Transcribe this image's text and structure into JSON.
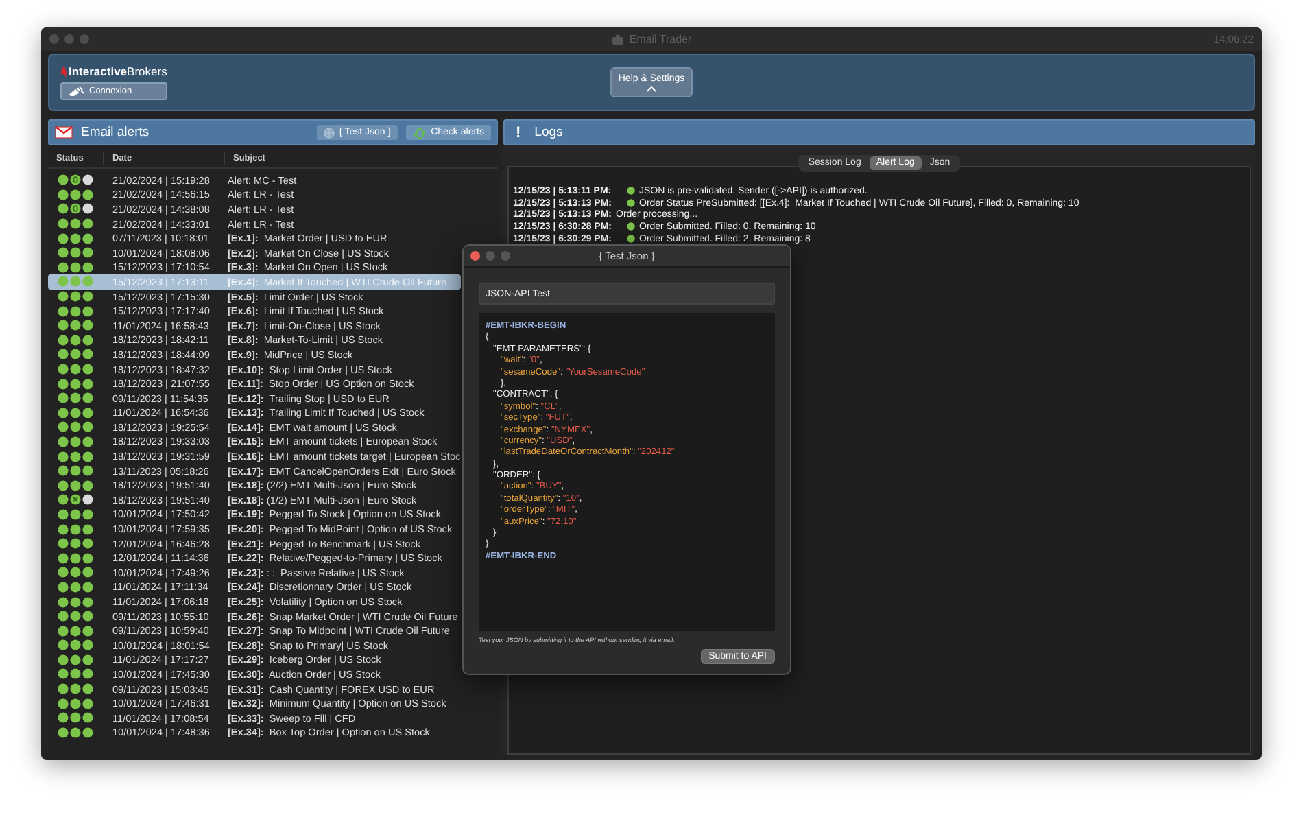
{
  "window": {
    "title": "Email Trader",
    "clock": "14:06:22"
  },
  "header": {
    "logo": "**Interactive**Brokers",
    "connect_button": "Connexion",
    "help_button": "Help & Settings"
  },
  "alerts": {
    "title": "Email alerts",
    "test_button": "{ Test Json }",
    "check_button": "Check alerts",
    "columns": [
      "Status",
      "Date",
      "Subject"
    ],
    "rows": [
      {
        "status": [
          {
            "kind": "plain",
            "color": "#7cc44a"
          },
          {
            "kind": "zero",
            "color": "#7cc44a"
          },
          {
            "kind": "plain",
            "color": "#d9d9d9"
          }
        ],
        "date": "21/02/2024 | 15:19:28",
        "subject": "Alert: MC - Test",
        "selected": false
      },
      {
        "status": [
          {
            "kind": "plain",
            "color": "#7cc44a"
          },
          {
            "kind": "plain",
            "color": "#7cc44a"
          },
          {
            "kind": "plain",
            "color": "#7cc44a"
          }
        ],
        "date": "21/02/2024 | 14:56:15",
        "subject": "Alert: LR - Test",
        "selected": false
      },
      {
        "status": [
          {
            "kind": "plain",
            "color": "#7cc44a"
          },
          {
            "kind": "zero",
            "color": "#7cc44a"
          },
          {
            "kind": "plain",
            "color": "#d9d9d9"
          }
        ],
        "date": "21/02/2024 | 14:38:08",
        "subject": "Alert: LR - Test",
        "selected": false
      },
      {
        "status": [
          {
            "kind": "plain",
            "color": "#7cc44a"
          },
          {
            "kind": "plain",
            "color": "#7cc44a"
          },
          {
            "kind": "plain",
            "color": "#7cc44a"
          }
        ],
        "date": "21/02/2024 | 14:33:01",
        "subject": "Alert: LR - Test",
        "selected": false
      },
      {
        "status": [
          {
            "kind": "plain",
            "color": "#7cc44a"
          },
          {
            "kind": "plain",
            "color": "#7cc44a"
          },
          {
            "kind": "plain",
            "color": "#7cc44a"
          }
        ],
        "date": "07/11/2023 | 10:18:01",
        "subject": "**[Ex.1]:**  Market Order | USD to EUR",
        "selected": false
      },
      {
        "status": [
          {
            "kind": "plain",
            "color": "#7cc44a"
          },
          {
            "kind": "plain",
            "color": "#7cc44a"
          },
          {
            "kind": "plain",
            "color": "#7cc44a"
          }
        ],
        "date": "10/01/2024 | 18:08:06",
        "subject": "**[Ex.2]:**  Market On Close | US Stock",
        "selected": false
      },
      {
        "status": [
          {
            "kind": "plain",
            "color": "#7cc44a"
          },
          {
            "kind": "plain",
            "color": "#7cc44a"
          },
          {
            "kind": "plain",
            "color": "#7cc44a"
          }
        ],
        "date": "15/12/2023 | 17:10:54",
        "subject": "**[Ex.3]:**  Market On Open | US Stock",
        "selected": false
      },
      {
        "status": [
          {
            "kind": "plain",
            "color": "#7cc44a"
          },
          {
            "kind": "plain",
            "color": "#7cc44a"
          },
          {
            "kind": "plain",
            "color": "#7cc44a"
          }
        ],
        "date": "15/12/2023 | 17:13:11",
        "subject": "**[Ex.4]:**  Market If Touched | WTI Crude Oil Future",
        "selected": true
      },
      {
        "status": [
          {
            "kind": "plain",
            "color": "#7cc44a"
          },
          {
            "kind": "plain",
            "color": "#7cc44a"
          },
          {
            "kind": "plain",
            "color": "#7cc44a"
          }
        ],
        "date": "15/12/2023 | 17:15:30",
        "subject": "**[Ex.5]:**  Limit Order | US Stock",
        "selected": false
      },
      {
        "status": [
          {
            "kind": "plain",
            "color": "#7cc44a"
          },
          {
            "kind": "plain",
            "color": "#7cc44a"
          },
          {
            "kind": "plain",
            "color": "#7cc44a"
          }
        ],
        "date": "15/12/2023 | 17:17:40",
        "subject": "**[Ex.6]:**  Limit If Touched | US Stock",
        "selected": false
      },
      {
        "status": [
          {
            "kind": "plain",
            "color": "#7cc44a"
          },
          {
            "kind": "plain",
            "color": "#7cc44a"
          },
          {
            "kind": "plain",
            "color": "#7cc44a"
          }
        ],
        "date": "11/01/2024 | 16:58:43",
        "subject": "**[Ex.7]:**  Limit-On-Close | US Stock",
        "selected": false
      },
      {
        "status": [
          {
            "kind": "plain",
            "color": "#7cc44a"
          },
          {
            "kind": "plain",
            "color": "#7cc44a"
          },
          {
            "kind": "plain",
            "color": "#7cc44a"
          }
        ],
        "date": "18/12/2023 | 18:42:11",
        "subject": "**[Ex.8]:**  Market-To-Limit | US Stock",
        "selected": false
      },
      {
        "status": [
          {
            "kind": "plain",
            "color": "#7cc44a"
          },
          {
            "kind": "plain",
            "color": "#7cc44a"
          },
          {
            "kind": "plain",
            "color": "#7cc44a"
          }
        ],
        "date": "18/12/2023 | 18:44:09",
        "subject": "**[Ex.9]:**  MidPrice | US Stock",
        "selected": false
      },
      {
        "status": [
          {
            "kind": "plain",
            "color": "#7cc44a"
          },
          {
            "kind": "plain",
            "color": "#7cc44a"
          },
          {
            "kind": "plain",
            "color": "#7cc44a"
          }
        ],
        "date": "18/12/2023 | 18:47:32",
        "subject": "**[Ex.10]:**  Stop Limit Order | US Stock",
        "selected": false
      },
      {
        "status": [
          {
            "kind": "plain",
            "color": "#7cc44a"
          },
          {
            "kind": "plain",
            "color": "#7cc44a"
          },
          {
            "kind": "plain",
            "color": "#7cc44a"
          }
        ],
        "date": "18/12/2023 | 21:07:55",
        "subject": "**[Ex.11]:**  Stop Order | US Option on Stock",
        "selected": false
      },
      {
        "status": [
          {
            "kind": "plain",
            "color": "#7cc44a"
          },
          {
            "kind": "plain",
            "color": "#7cc44a"
          },
          {
            "kind": "plain",
            "color": "#7cc44a"
          }
        ],
        "date": "09/11/2023 | 11:54:35",
        "subject": "**[Ex.12]:**  Trailing Stop | USD to EUR",
        "selected": false
      },
      {
        "status": [
          {
            "kind": "plain",
            "color": "#7cc44a"
          },
          {
            "kind": "plain",
            "color": "#7cc44a"
          },
          {
            "kind": "plain",
            "color": "#7cc44a"
          }
        ],
        "date": "11/01/2024 | 16:54:36",
        "subject": "**[Ex.13]:**  Trailing Limit If Touched | US Stock",
        "selected": false
      },
      {
        "status": [
          {
            "kind": "plain",
            "color": "#7cc44a"
          },
          {
            "kind": "plain",
            "color": "#7cc44a"
          },
          {
            "kind": "plain",
            "color": "#7cc44a"
          }
        ],
        "date": "18/12/2023 | 19:25:54",
        "subject": "**[Ex.14]:**  EMT wait amount | US Stock",
        "selected": false
      },
      {
        "status": [
          {
            "kind": "plain",
            "color": "#7cc44a"
          },
          {
            "kind": "plain",
            "color": "#7cc44a"
          },
          {
            "kind": "plain",
            "color": "#7cc44a"
          }
        ],
        "date": "18/12/2023 | 19:33:03",
        "subject": "**[Ex.15]:**  EMT amount tickets | European Stock",
        "selected": false
      },
      {
        "status": [
          {
            "kind": "plain",
            "color": "#7cc44a"
          },
          {
            "kind": "plain",
            "color": "#7cc44a"
          },
          {
            "kind": "plain",
            "color": "#7cc44a"
          }
        ],
        "date": "18/12/2023 | 19:31:59",
        "subject": "**[Ex.16]:**  EMT amount tickets target | European Stoc",
        "selected": false
      },
      {
        "status": [
          {
            "kind": "plain",
            "color": "#7cc44a"
          },
          {
            "kind": "plain",
            "color": "#7cc44a"
          },
          {
            "kind": "plain",
            "color": "#7cc44a"
          }
        ],
        "date": "13/11/2023 | 05:18:26",
        "subject": "**[Ex.17]:**  EMT CancelOpenOrders Exit | Euro Stock",
        "selected": false
      },
      {
        "status": [
          {
            "kind": "plain",
            "color": "#7cc44a"
          },
          {
            "kind": "plain",
            "color": "#7cc44a"
          },
          {
            "kind": "plain",
            "color": "#7cc44a"
          }
        ],
        "date": "18/12/2023 | 19:51:40",
        "subject": "**[Ex.18]:** (2/2) EMT Multi-Json | Euro Stock",
        "selected": false
      },
      {
        "status": [
          {
            "kind": "plain",
            "color": "#7cc44a"
          },
          {
            "kind": "cross",
            "color": "#7cc44a"
          },
          {
            "kind": "plain",
            "color": "#d9d9d9"
          }
        ],
        "date": "18/12/2023 | 19:51:40",
        "subject": "**[Ex.18]:** (1/2) EMT Multi-Json | Euro Stock",
        "selected": false
      },
      {
        "status": [
          {
            "kind": "plain",
            "color": "#7cc44a"
          },
          {
            "kind": "plain",
            "color": "#7cc44a"
          },
          {
            "kind": "plain",
            "color": "#7cc44a"
          }
        ],
        "date": "10/01/2024 | 17:50:42",
        "subject": "**[Ex.19]:**  Pegged To Stock | Option on US Stock",
        "selected": false
      },
      {
        "status": [
          {
            "kind": "plain",
            "color": "#7cc44a"
          },
          {
            "kind": "plain",
            "color": "#7cc44a"
          },
          {
            "kind": "plain",
            "color": "#7cc44a"
          }
        ],
        "date": "10/01/2024 | 17:59:35",
        "subject": "**[Ex.20]:**  Pegged To MidPoint | Option of US Stock",
        "selected": false
      },
      {
        "status": [
          {
            "kind": "plain",
            "color": "#7cc44a"
          },
          {
            "kind": "plain",
            "color": "#7cc44a"
          },
          {
            "kind": "plain",
            "color": "#7cc44a"
          }
        ],
        "date": "12/01/2024 | 16:46:28",
        "subject": "**[Ex.21]:**  Pegged To Benchmark | US Stock",
        "selected": false
      },
      {
        "status": [
          {
            "kind": "plain",
            "color": "#7cc44a"
          },
          {
            "kind": "plain",
            "color": "#7cc44a"
          },
          {
            "kind": "plain",
            "color": "#7cc44a"
          }
        ],
        "date": "12/01/2024 | 11:14:36",
        "subject": "**[Ex.22]:**  Relative/Pegged-to-Primary | US Stock",
        "selected": false
      },
      {
        "status": [
          {
            "kind": "plain",
            "color": "#7cc44a"
          },
          {
            "kind": "plain",
            "color": "#7cc44a"
          },
          {
            "kind": "plain",
            "color": "#7cc44a"
          }
        ],
        "date": "10/01/2024 | 17:49:26",
        "subject": "**[Ex.23]:** : :  Passive Relative | US Stock",
        "selected": false
      },
      {
        "status": [
          {
            "kind": "plain",
            "color": "#7cc44a"
          },
          {
            "kind": "plain",
            "color": "#7cc44a"
          },
          {
            "kind": "plain",
            "color": "#7cc44a"
          }
        ],
        "date": "11/01/2024 | 17:11:34",
        "subject": "**[Ex.24]:**  Discretionnary Order | US Stock",
        "selected": false
      },
      {
        "status": [
          {
            "kind": "plain",
            "color": "#7cc44a"
          },
          {
            "kind": "plain",
            "color": "#7cc44a"
          },
          {
            "kind": "plain",
            "color": "#7cc44a"
          }
        ],
        "date": "11/01/2024 | 17:06:18",
        "subject": "**[Ex.25]:**  Volatility | Option on US Stock",
        "selected": false
      },
      {
        "status": [
          {
            "kind": "plain",
            "color": "#7cc44a"
          },
          {
            "kind": "plain",
            "color": "#7cc44a"
          },
          {
            "kind": "plain",
            "color": "#7cc44a"
          }
        ],
        "date": "09/11/2023 | 10:55:10",
        "subject": "**[Ex.26]:**  Snap Market Order | WTI Crude Oil Future",
        "selected": false
      },
      {
        "status": [
          {
            "kind": "plain",
            "color": "#7cc44a"
          },
          {
            "kind": "plain",
            "color": "#7cc44a"
          },
          {
            "kind": "plain",
            "color": "#7cc44a"
          }
        ],
        "date": "09/11/2023 | 10:59:40",
        "subject": "**[Ex.27]:**  Snap To Midpoint | WTI Crude Oil Future",
        "selected": false
      },
      {
        "status": [
          {
            "kind": "plain",
            "color": "#7cc44a"
          },
          {
            "kind": "plain",
            "color": "#7cc44a"
          },
          {
            "kind": "plain",
            "color": "#7cc44a"
          }
        ],
        "date": "10/01/2024 | 18:01:54",
        "subject": "**[Ex.28]:**  Snap to Primary| US Stock",
        "selected": false
      },
      {
        "status": [
          {
            "kind": "plain",
            "color": "#7cc44a"
          },
          {
            "kind": "plain",
            "color": "#7cc44a"
          },
          {
            "kind": "plain",
            "color": "#7cc44a"
          }
        ],
        "date": "11/01/2024 | 17:17:27",
        "subject": "**[Ex.29]:**  Iceberg Order | US Stock",
        "selected": false
      },
      {
        "status": [
          {
            "kind": "plain",
            "color": "#7cc44a"
          },
          {
            "kind": "plain",
            "color": "#7cc44a"
          },
          {
            "kind": "plain",
            "color": "#7cc44a"
          }
        ],
        "date": "10/01/2024 | 17:45:30",
        "subject": "**[Ex.30]:**  Auction Order | US Stock",
        "selected": false
      },
      {
        "status": [
          {
            "kind": "plain",
            "color": "#7cc44a"
          },
          {
            "kind": "plain",
            "color": "#7cc44a"
          },
          {
            "kind": "plain",
            "color": "#7cc44a"
          }
        ],
        "date": "09/11/2023 | 15:03:45",
        "subject": "**[Ex.31]:**  Cash Quantity | FOREX USD to EUR",
        "selected": false
      },
      {
        "status": [
          {
            "kind": "plain",
            "color": "#7cc44a"
          },
          {
            "kind": "plain",
            "color": "#7cc44a"
          },
          {
            "kind": "plain",
            "color": "#7cc44a"
          }
        ],
        "date": "10/01/2024 | 17:46:31",
        "subject": "**[Ex.32]:**  Minimum Quantity | Option on US Stock",
        "selected": false
      },
      {
        "status": [
          {
            "kind": "plain",
            "color": "#7cc44a"
          },
          {
            "kind": "plain",
            "color": "#7cc44a"
          },
          {
            "kind": "plain",
            "color": "#7cc44a"
          }
        ],
        "date": "11/01/2024 | 17:08:54",
        "subject": "**[Ex.33]:**  Sweep to Fill | CFD",
        "selected": false
      },
      {
        "status": [
          {
            "kind": "plain",
            "color": "#7cc44a"
          },
          {
            "kind": "plain",
            "color": "#7cc44a"
          },
          {
            "kind": "plain",
            "color": "#7cc44a"
          }
        ],
        "date": "10/01/2024 | 17:48:36",
        "subject": "**[Ex.34]:**  Box Top Order | Option on US Stock",
        "selected": false
      }
    ]
  },
  "logs": {
    "icon": "!",
    "title": "Logs",
    "tabs": [
      {
        "label": "Session Log",
        "selected": false
      },
      {
        "label": "Alert Log",
        "selected": true
      },
      {
        "label": "Json",
        "selected": false
      }
    ],
    "entries": [
      {
        "time": "12/15/23 | 5:13:11 PM:",
        "dot": true,
        "message": "JSON is pre-validated. Sender ([->API]) is authorized."
      },
      {
        "time": "12/15/23 | 5:13:13 PM:",
        "dot": true,
        "message": "Order Status PreSubmitted: [[Ex.4]:  Market If Touched | WTI Crude Oil Future], Filled: 0, Remaining: 10"
      },
      {
        "time": "12/15/23 | 5:13:13 PM:",
        "dot": false,
        "message": "Order processing..."
      },
      {
        "time": "12/15/23 | 6:30:28 PM:",
        "dot": true,
        "message": "Order Submitted. Filled: 0, Remaining: 10"
      },
      {
        "time": "12/15/23 | 6:30:29 PM:",
        "dot": true,
        "message": "Order Submitted. Filled: 2, Remaining: 8"
      }
    ]
  },
  "dialog": {
    "title": "{ Test Json }",
    "name_field": "JSON-API Test",
    "code": [
      [
        {
          "kind": "marker",
          "text": "#EMT-IBKR-BEGIN"
        }
      ],
      [
        {
          "kind": "punct",
          "text": "{"
        }
      ],
      [
        {
          "kind": "section",
          "text": "   \"EMT-PARAMETERS\""
        },
        {
          "kind": "punct",
          "text": ": {"
        }
      ],
      [
        {
          "kind": "key",
          "text": "      \"wait\""
        },
        {
          "kind": "punct",
          "text": ": "
        },
        {
          "kind": "value",
          "text": "\"0\""
        },
        {
          "kind": "punct",
          "text": ","
        }
      ],
      [
        {
          "kind": "key",
          "text": "      \"sesameCode\""
        },
        {
          "kind": "punct",
          "text": ": "
        },
        {
          "kind": "value",
          "text": "\"YourSesameCode\""
        }
      ],
      [
        {
          "kind": "punct",
          "text": "      },"
        }
      ],
      [
        {
          "kind": "section",
          "text": "   \"CONTRACT\""
        },
        {
          "kind": "punct",
          "text": ": {"
        }
      ],
      [
        {
          "kind": "key",
          "text": "      \"symbol\""
        },
        {
          "kind": "punct",
          "text": ": "
        },
        {
          "kind": "value",
          "text": "\"CL\""
        },
        {
          "kind": "punct",
          "text": ","
        }
      ],
      [
        {
          "kind": "key",
          "text": "      \"secType\""
        },
        {
          "kind": "punct",
          "text": ": "
        },
        {
          "kind": "value",
          "text": "\"FUT\""
        },
        {
          "kind": "punct",
          "text": ","
        }
      ],
      [
        {
          "kind": "key",
          "text": "      \"exchange\""
        },
        {
          "kind": "punct",
          "text": ": "
        },
        {
          "kind": "value",
          "text": "\"NYMEX\""
        },
        {
          "kind": "punct",
          "text": ","
        }
      ],
      [
        {
          "kind": "key",
          "text": "      \"currency\""
        },
        {
          "kind": "punct",
          "text": ": "
        },
        {
          "kind": "value",
          "text": "\"USD\""
        },
        {
          "kind": "punct",
          "text": ","
        }
      ],
      [
        {
          "kind": "key",
          "text": "      \"lastTradeDateOrContractMonth\""
        },
        {
          "kind": "punct",
          "text": ": "
        },
        {
          "kind": "value",
          "text": "\"202412\""
        }
      ],
      [
        {
          "kind": "punct",
          "text": "   },"
        }
      ],
      [
        {
          "kind": "section",
          "text": "   \"ORDER\""
        },
        {
          "kind": "punct",
          "text": ": {"
        }
      ],
      [
        {
          "kind": "key",
          "text": "      \"action\""
        },
        {
          "kind": "punct",
          "text": ": "
        },
        {
          "kind": "value",
          "text": "\"BUY\""
        },
        {
          "kind": "punct",
          "text": ","
        }
      ],
      [
        {
          "kind": "key",
          "text": "      \"totalQuantity\""
        },
        {
          "kind": "punct",
          "text": ": "
        },
        {
          "kind": "value",
          "text": "\"10\""
        },
        {
          "kind": "punct",
          "text": ","
        }
      ],
      [
        {
          "kind": "key",
          "text": "      \"orderType\""
        },
        {
          "kind": "punct",
          "text": ": "
        },
        {
          "kind": "value",
          "text": "\"MIT\""
        },
        {
          "kind": "punct",
          "text": ","
        }
      ],
      [
        {
          "kind": "key",
          "text": "      \"auxPrice\""
        },
        {
          "kind": "punct",
          "text": ": "
        },
        {
          "kind": "value",
          "text": "\"72.10\""
        }
      ],
      [
        {
          "kind": "punct",
          "text": "   }"
        }
      ],
      [
        {
          "kind": "punct",
          "text": "}"
        }
      ],
      [
        {
          "kind": "marker",
          "text": "#EMT-IBKR-END"
        }
      ]
    ],
    "hint": "Test your JSON by submitting it to the API without sending it via email.",
    "submit_button": "Submit to API"
  }
}
